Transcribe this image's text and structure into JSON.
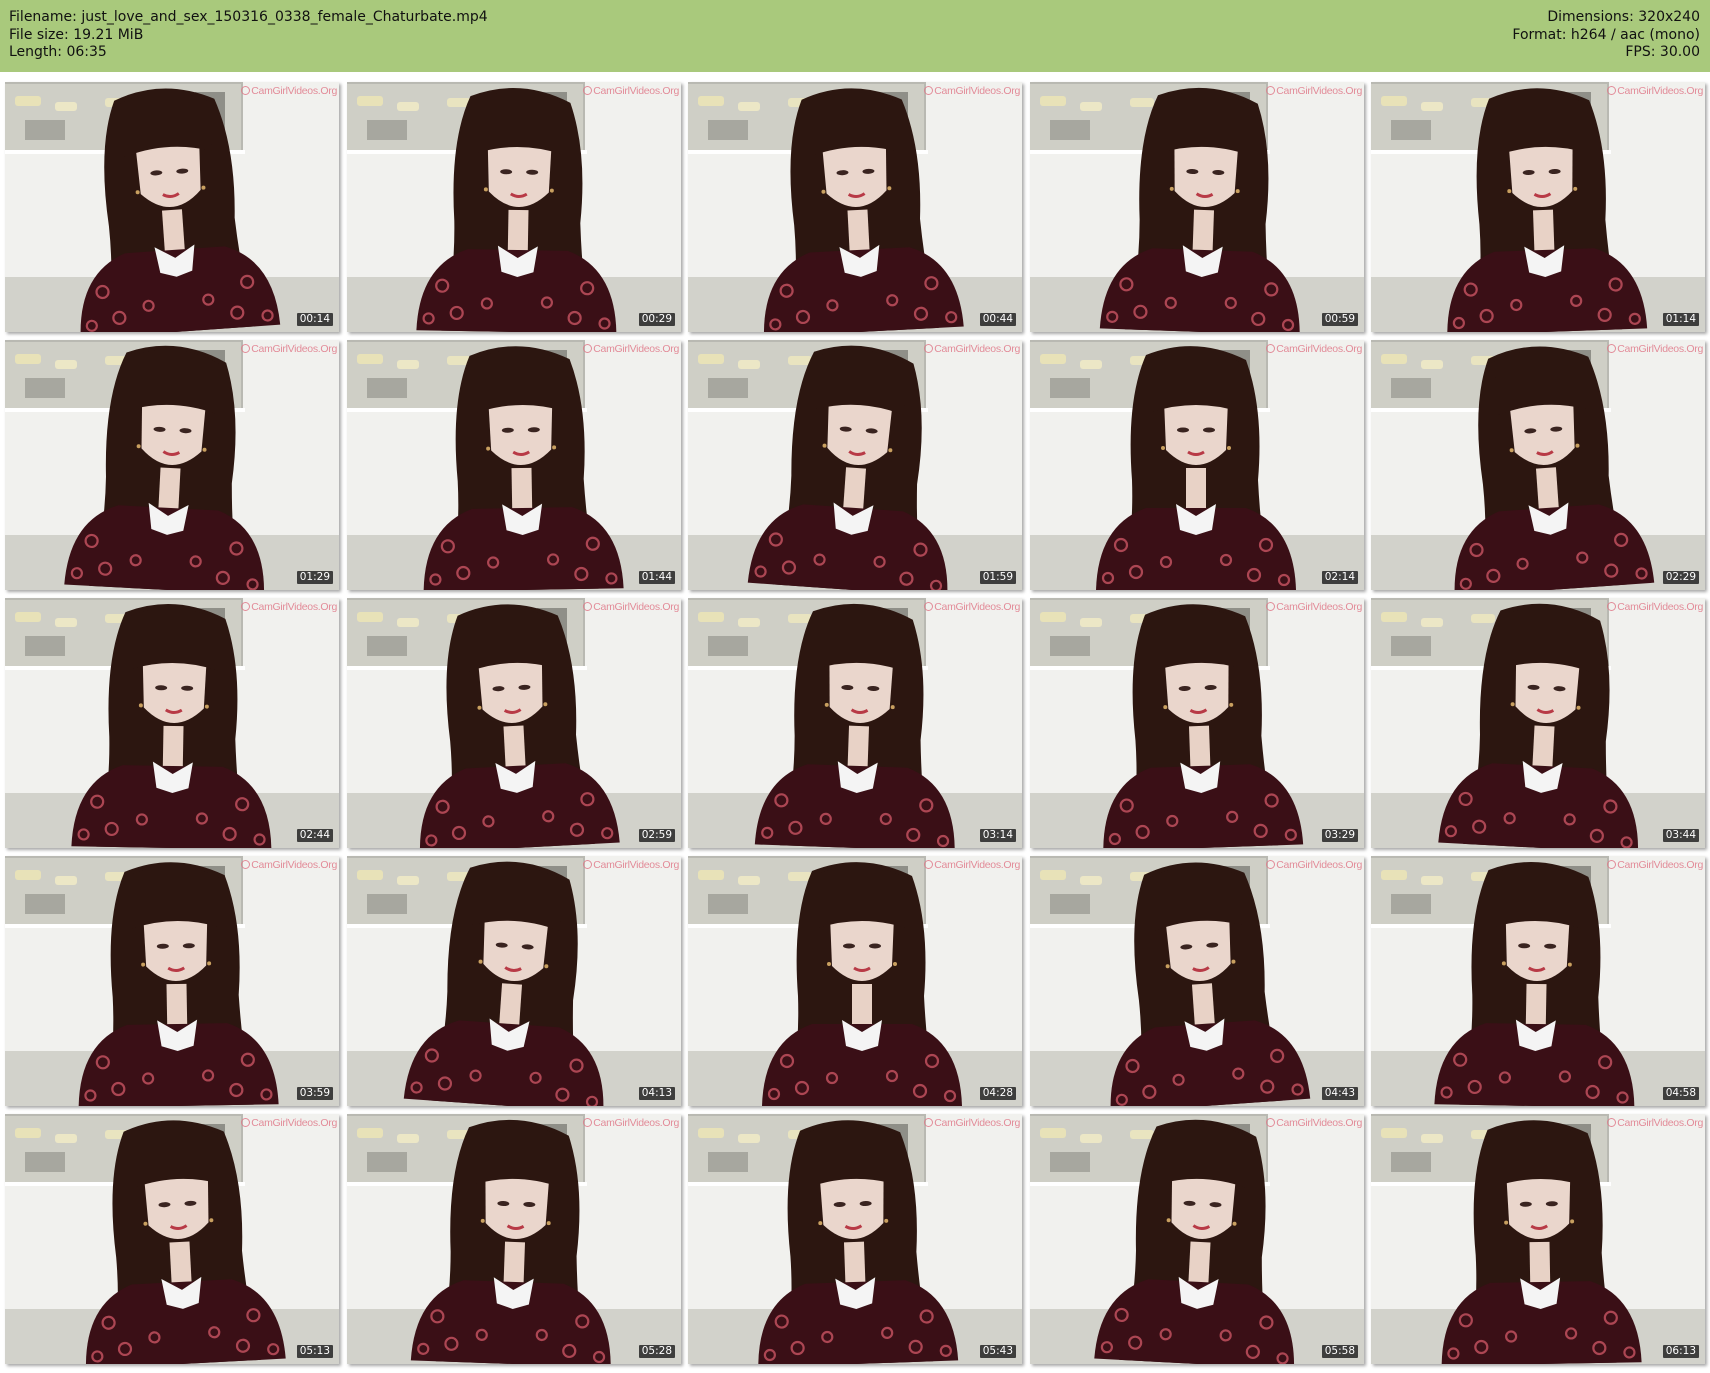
{
  "header": {
    "filename_label": "Filename:",
    "filename": "just_love_and_sex_150316_0338_female_Chaturbate.mp4",
    "filesize_label": "File size:",
    "filesize": "19.21 MiB",
    "length_label": "Length:",
    "length": "06:35",
    "dimensions_label": "Dimensions:",
    "dimensions": "320x240",
    "format_label": "Format:",
    "format": "h264 / aac (mono)",
    "fps_label": "FPS:",
    "fps": "30.00"
  },
  "watermark": "CamGirlVideos.Org",
  "colors": {
    "header_bg": "#a9c97c",
    "dress": "#3a0f16",
    "dress_pattern": "#c0505e",
    "hair": "#2c1610",
    "collar": "#f4f4f4",
    "timestamp_bg": "#1e1e1e"
  },
  "thumbnails": [
    {
      "time": "00:14"
    },
    {
      "time": "00:29"
    },
    {
      "time": "00:44"
    },
    {
      "time": "00:59"
    },
    {
      "time": "01:14"
    },
    {
      "time": "01:29"
    },
    {
      "time": "01:44"
    },
    {
      "time": "01:59"
    },
    {
      "time": "02:14"
    },
    {
      "time": "02:29"
    },
    {
      "time": "02:44"
    },
    {
      "time": "02:59"
    },
    {
      "time": "03:14"
    },
    {
      "time": "03:29"
    },
    {
      "time": "03:44"
    },
    {
      "time": "03:59"
    },
    {
      "time": "04:13"
    },
    {
      "time": "04:28"
    },
    {
      "time": "04:43"
    },
    {
      "time": "04:58"
    },
    {
      "time": "05:13"
    },
    {
      "time": "05:28"
    },
    {
      "time": "05:43"
    },
    {
      "time": "05:58"
    },
    {
      "time": "06:13"
    }
  ]
}
